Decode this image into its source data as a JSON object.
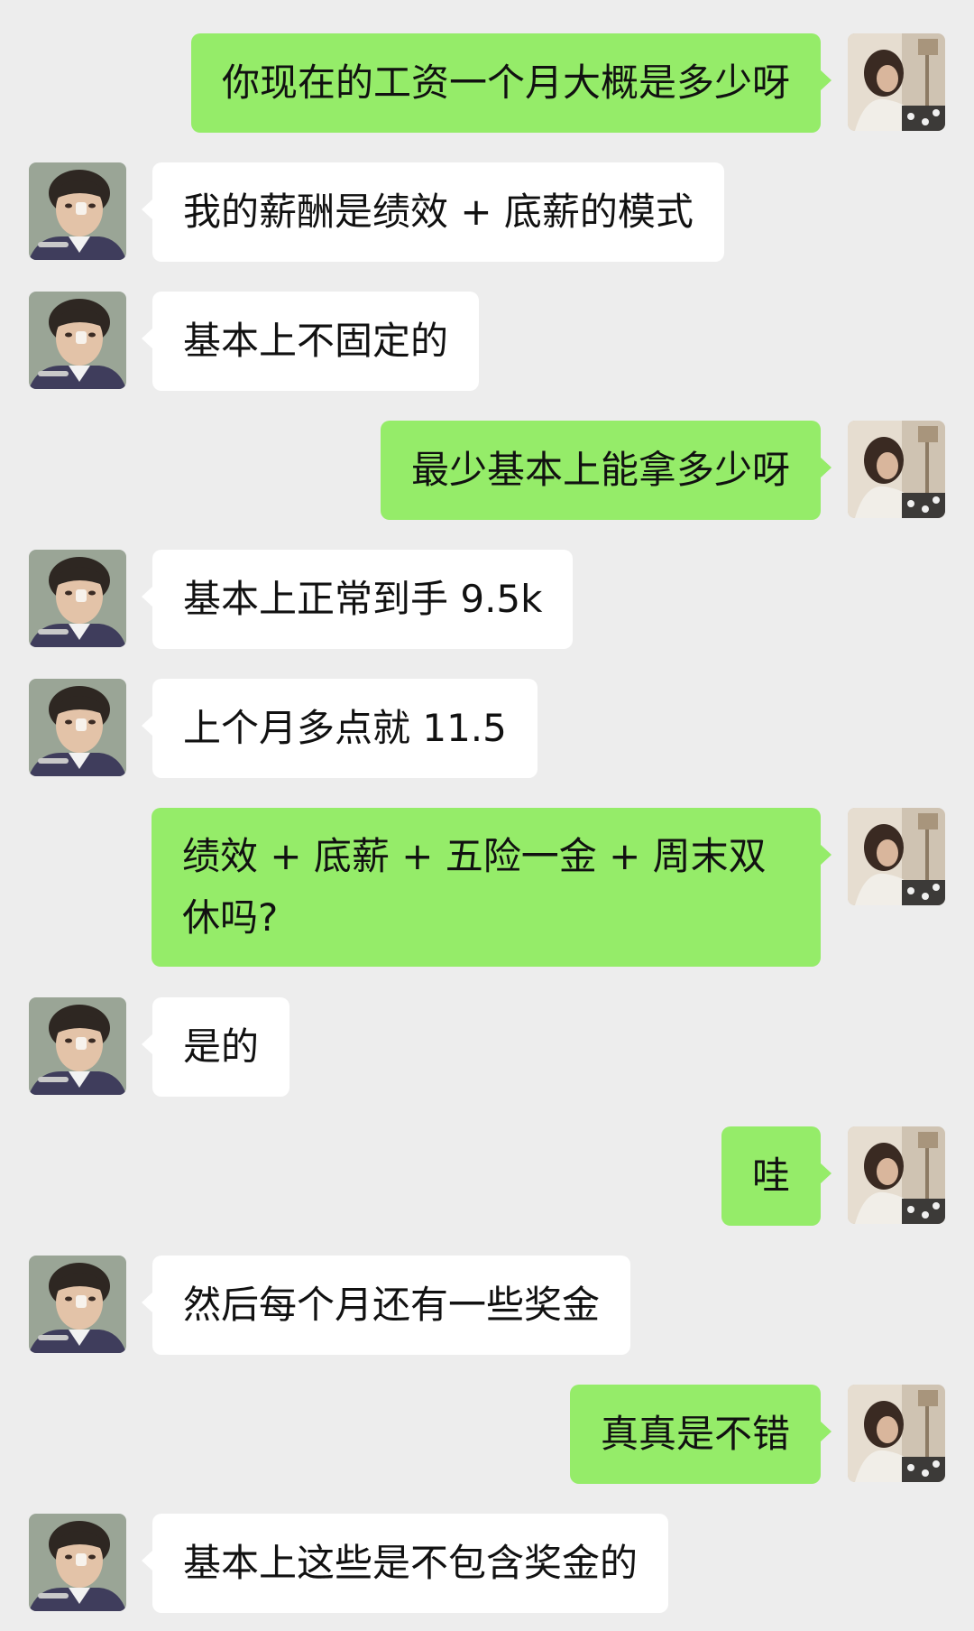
{
  "colors": {
    "background": "#ededed",
    "outgoing_bubble": "#95ec69",
    "incoming_bubble": "#ffffff",
    "text": "#111111"
  },
  "contacts": {
    "self_avatar": "self-avatar-photo",
    "other_avatar": "contact-avatar-photo"
  },
  "messages": [
    {
      "sender": "self",
      "text": "你现在的工资一个月大概是多少呀"
    },
    {
      "sender": "other",
      "text": "我的薪酬是绩效 + 底薪的模式"
    },
    {
      "sender": "other",
      "text": "基本上不固定的"
    },
    {
      "sender": "self",
      "text": "最少基本上能拿多少呀"
    },
    {
      "sender": "other",
      "text": "基本上正常到手 9.5k"
    },
    {
      "sender": "other",
      "text": "上个月多点就 11.5"
    },
    {
      "sender": "self",
      "text": "绩效 + 底薪 + 五险一金 + 周末双休吗?"
    },
    {
      "sender": "other",
      "text": "是的"
    },
    {
      "sender": "self",
      "text": "哇"
    },
    {
      "sender": "other",
      "text": "然后每个月还有一些奖金"
    },
    {
      "sender": "self",
      "text": "真真是不错"
    },
    {
      "sender": "other",
      "text": "基本上这些是不包含奖金的"
    }
  ]
}
